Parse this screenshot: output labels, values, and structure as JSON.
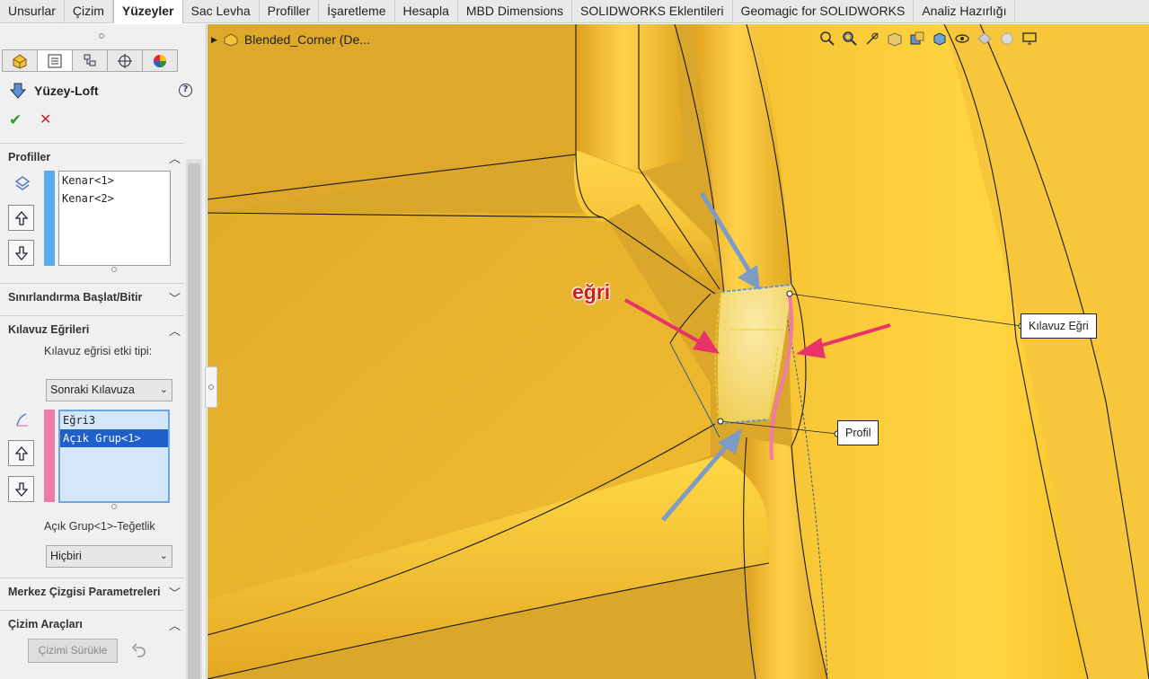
{
  "ribbon": {
    "tabs": [
      {
        "label": "Unsurlar",
        "active": false
      },
      {
        "label": "Çizim",
        "active": false
      },
      {
        "label": "Yüzeyler",
        "active": true
      },
      {
        "label": "Sac Levha",
        "active": false
      },
      {
        "label": "Profiller",
        "active": false
      },
      {
        "label": "İşaretleme",
        "active": false
      },
      {
        "label": "Hesapla",
        "active": false
      },
      {
        "label": "MBD Dimensions",
        "active": false
      },
      {
        "label": "SOLIDWORKS Eklentileri",
        "active": false
      },
      {
        "label": "Geomagic for SOLIDWORKS",
        "active": false
      },
      {
        "label": "Analiz Hazırlığı",
        "active": false
      }
    ]
  },
  "property_manager": {
    "title": "Yüzey-Loft",
    "profiles": {
      "header": "Profiller",
      "items": [
        "Kenar<1>",
        "Kenar<2>"
      ]
    },
    "start_end_constraints": {
      "header": "Sınırlandırma Başlat/Bitir"
    },
    "guide_curves": {
      "header": "Kılavuz Eğrileri",
      "influence_label": "Kılavuz eğrisi etki tipi:",
      "influence_value": "Sonraki Kılavuza",
      "items": [
        "Eğri3",
        "Açık Grup<1>"
      ],
      "selected_index": 1,
      "tangency_label": "Açık Grup<1>-Teğetlik",
      "tangency_value": "Hiçbiri"
    },
    "centerline": {
      "header": "Merkez Çizgisi Parametreleri"
    },
    "sketch_tools": {
      "header": "Çizim Araçları",
      "drag_sketch_label": "Çizimi Sürükle"
    }
  },
  "viewport": {
    "breadcrumb": "Blended_Corner  (De...",
    "callouts": {
      "guide_curve": "Kılavuz Eğri",
      "profile": "Profil"
    },
    "annotation_label": "eğri",
    "colors": {
      "part": "#f2c12e",
      "guide_curve": "#f07aa8",
      "annotation_arrow_red": "#e8326a",
      "annotation_arrow_blue": "#7d9bc4"
    }
  }
}
